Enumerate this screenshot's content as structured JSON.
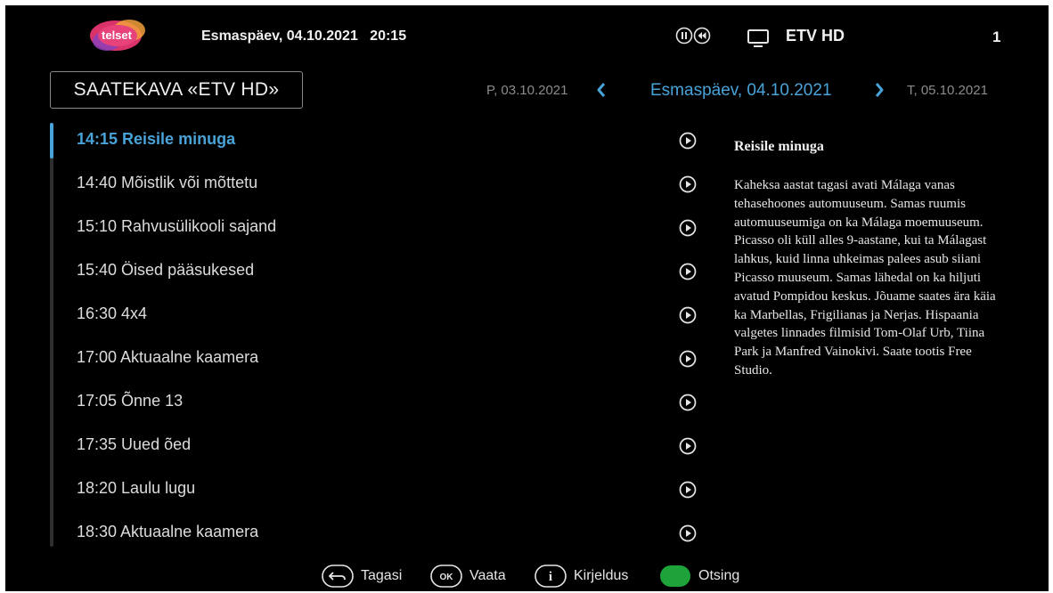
{
  "header": {
    "logo_text": "telset",
    "datetime": "Esmaspäev, 04.10.2021   20:15",
    "channel": "ETV HD",
    "channel_number": "1",
    "icons": [
      "pause-icon",
      "rewind-icon",
      "tv-icon"
    ]
  },
  "title": "SAATEKAVA «ETV HD»",
  "date_nav": {
    "prev": "P, 03.10.2021",
    "current": "Esmaspäev, 04.10.2021",
    "next": "T, 05.10.2021"
  },
  "programs": [
    {
      "label": "14:15 Reisile minuga",
      "active": true
    },
    {
      "label": "14:40 Mõistlik või mõttetu"
    },
    {
      "label": "15:10 Rahvusülikooli sajand"
    },
    {
      "label": "15:40 Öised pääsukesed"
    },
    {
      "label": "16:30 4x4"
    },
    {
      "label": "17:00 Aktuaalne kaamera"
    },
    {
      "label": "17:05 Õnne 13"
    },
    {
      "label": "17:35 Uued õed"
    },
    {
      "label": "18:20 Laulu lugu"
    },
    {
      "label": "18:30 Aktuaalne kaamera"
    }
  ],
  "description": {
    "title": "Reisile minuga",
    "body": "Kaheksa aastat tagasi avati Málaga vanas tehasehoones automuuseum. Samas ruumis automuuseumiga on ka Málaga moemuuseum. Picasso oli küll alles 9-aastane, kui ta Málagast lahkus, kuid linna uhkeimas palees asub siiani Picasso muuseum. Samas lähedal on ka hiljuti avatud Pompidou keskus. Jõuame saates ära käia ka Marbellas, Frigilianas ja Nerjas. Hispaania valgetes linnades filmisid Tom-Olaf Urb, Tiina Park ja Manfred Vainokivi. Saate tootis Free Studio."
  },
  "footer": {
    "back": "Tagasi",
    "ok_key": "OK",
    "watch": "Vaata",
    "info_key": "i",
    "describe": "Kirjeldus",
    "search": "Otsing"
  },
  "colors": {
    "accent": "#4aa3d8",
    "background": "#000000",
    "green_key": "#1ea33a"
  }
}
